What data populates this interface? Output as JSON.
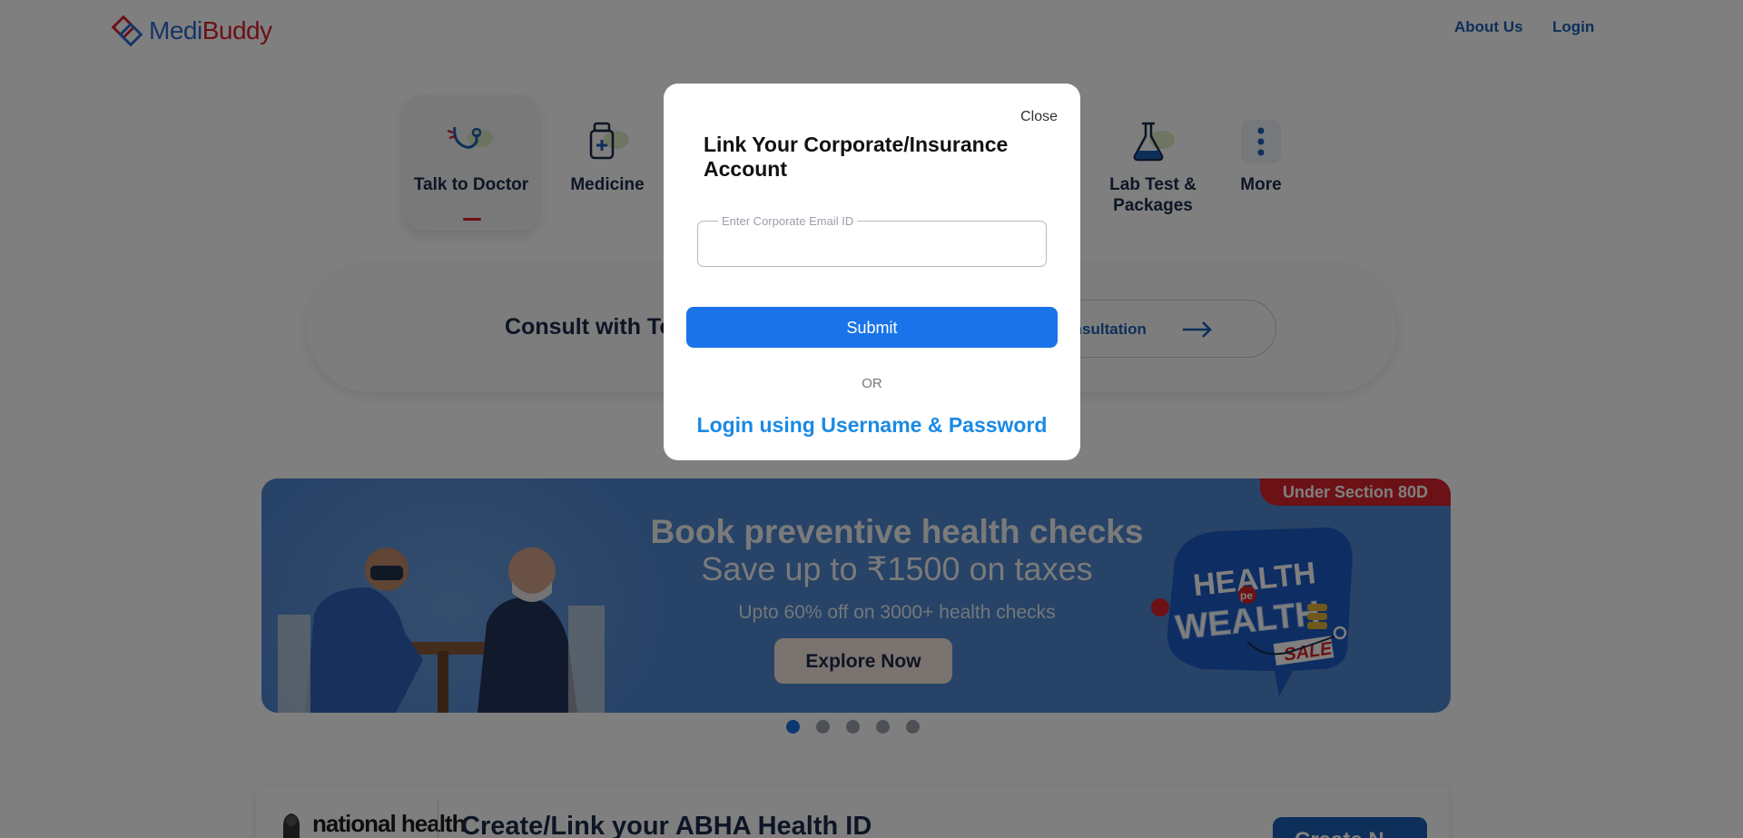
{
  "header": {
    "logo_text_part1": "Medi",
    "logo_text_part2": "Buddy",
    "nav": [
      "About Us",
      "Login"
    ]
  },
  "categories": [
    {
      "label": "Talk to Doctor",
      "icon": "stethoscope-icon",
      "active": true
    },
    {
      "label": "Medicine",
      "icon": "medicine-bottle-icon",
      "active": false
    },
    {
      "label": "Lab Test & Packages",
      "icon": "flask-icon",
      "active": false
    },
    {
      "label": "More",
      "icon": "more-vertical-icon",
      "active": false
    }
  ],
  "consult": {
    "text": "Consult with Top",
    "button": "Consultation"
  },
  "promo": {
    "badge": "Under Section 80D",
    "title": "Book preventive health checks",
    "subtitle": "Save up to ₹1500 on taxes",
    "small": "Upto 60% off on 3000+ health checks",
    "button": "Explore Now",
    "sale_line1": "HEALTH",
    "sale_pe": "pe",
    "sale_line2": "WEALTH",
    "sale_tag": "SALE"
  },
  "carousel": {
    "count": 5,
    "active_index": 0
  },
  "abha": {
    "logo_text": "national health",
    "title": "Create/Link your ABHA Health ID",
    "button": "Create N"
  },
  "modal": {
    "close": "Close",
    "title": "Link Your Corporate/Insurance Account",
    "email_label": "Enter Corporate Email ID",
    "email_value": "",
    "submit": "Submit",
    "or": "OR",
    "login_link": "Login using Username & Password"
  },
  "colors": {
    "brand_blue": "#1a5fb4",
    "brand_red": "#d8232a",
    "submit_blue": "#1a73e8",
    "link_blue": "#1a8ae6"
  }
}
